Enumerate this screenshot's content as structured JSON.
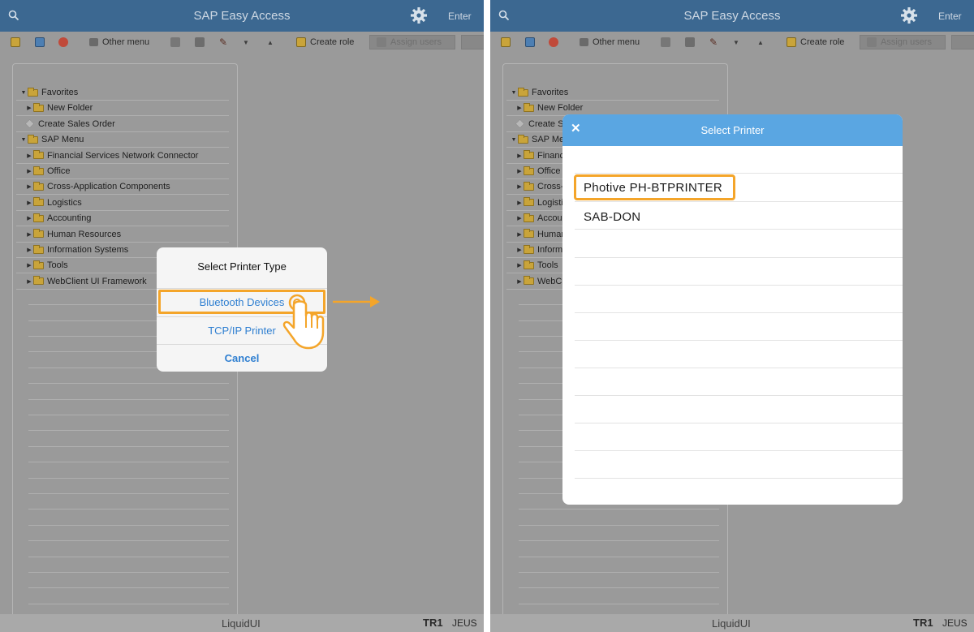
{
  "app": {
    "title": "SAP Easy Access",
    "enter_label": "Enter"
  },
  "toolbar": {
    "other_menu": "Other menu",
    "create_role": "Create role",
    "assign_users": "Assign users"
  },
  "tree": {
    "favorites": "Favorites",
    "new_folder": "New Folder",
    "create_sales_order": "Create Sales Order",
    "sap_menu": "SAP Menu",
    "items": [
      "Financial Services Network Connector",
      "Office",
      "Cross-Application Components",
      "Logistics",
      "Accounting",
      "Human Resources",
      "Information Systems",
      "Tools",
      "WebClient UI Framework"
    ],
    "items_truncated": [
      "Financ",
      "Office",
      "Cross-",
      "Logisti",
      "Accou",
      "Human",
      "Inform",
      "Tools",
      "WebCl"
    ],
    "create_sales_order_truncated": "Create S",
    "sap_menu_truncated": "SAP Men"
  },
  "footer": {
    "brand": "LiquidUI",
    "system": "TR1",
    "user": "JEUS"
  },
  "printer_type_sheet": {
    "title": "Select Printer Type",
    "option_bluetooth": "Bluetooth Devices",
    "option_tcpip": "TCP/IP Printer",
    "cancel": "Cancel"
  },
  "select_printer_dialog": {
    "title": "Select Printer",
    "close_glyph": "✕",
    "printers": [
      "Photive PH-BTPRINTER",
      "SAB-DON"
    ]
  },
  "colors": {
    "header_bg": "#3c6891",
    "highlight": "#f4a52a",
    "link_blue": "#2f7fd1",
    "dialog_header": "#5aa6e2"
  }
}
